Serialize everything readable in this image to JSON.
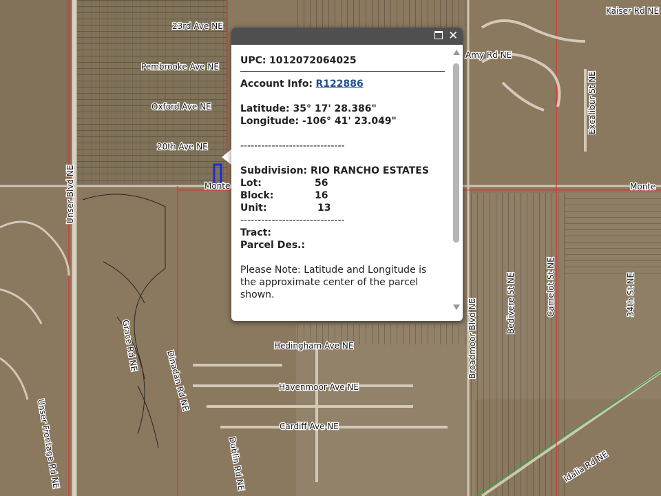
{
  "map": {
    "roads": [
      "23rd Ave NE",
      "Pembrooke Ave NE",
      "Oxford Ave NE",
      "20th Ave NE",
      "Monte",
      "Monte",
      "Kaiser Rd NE",
      "Amy Rd NE",
      "Unser Blvd NE",
      "Excalibur St NE",
      "Bedivere St NE",
      "Camelot St NE",
      "34th St NE",
      "Broadmoor Blvd NE",
      "Hedingham Ave NE",
      "Havenmoor Ave NE",
      "Cardiff Ave NE",
      "Grace Rd NE",
      "Dinadan Rd NE",
      "Unser Frontage Rd NE",
      "Idalia Rd NE",
      "Dublin Rd NE"
    ],
    "colors": {
      "imagery": "#8c7a62",
      "parcel_line": "#1f1f1f",
      "boundary": "#e03030",
      "highlight": "#1e2bd6",
      "green_line": "#3aa23a"
    }
  },
  "popup": {
    "upc_label": "UPC:",
    "upc_value": "1012072064025",
    "account_label": "Account Info:",
    "account_value": "R122886",
    "latitude_label": "Latitude:",
    "latitude_value": "35° 17' 28.386\"",
    "longitude_label": "Longitude:",
    "longitude_value": "-106° 41' 23.049\"",
    "separator": "------------------------------",
    "subdivision_label": "Subdivision:",
    "subdivision_value": "RIO RANCHO ESTATES",
    "lot_label": "Lot:",
    "lot_value": "56",
    "block_label": "Block:",
    "block_value": "16",
    "unit_label": "Unit:",
    "unit_value": "13",
    "tract_label": "Tract:",
    "parcel_des_label": "Parcel Des.:",
    "note": "Please Note: Latitude and Longitude is the approximate center of the parcel shown.",
    "maximize_icon": "maximize-icon",
    "close_symbol": "✕"
  }
}
